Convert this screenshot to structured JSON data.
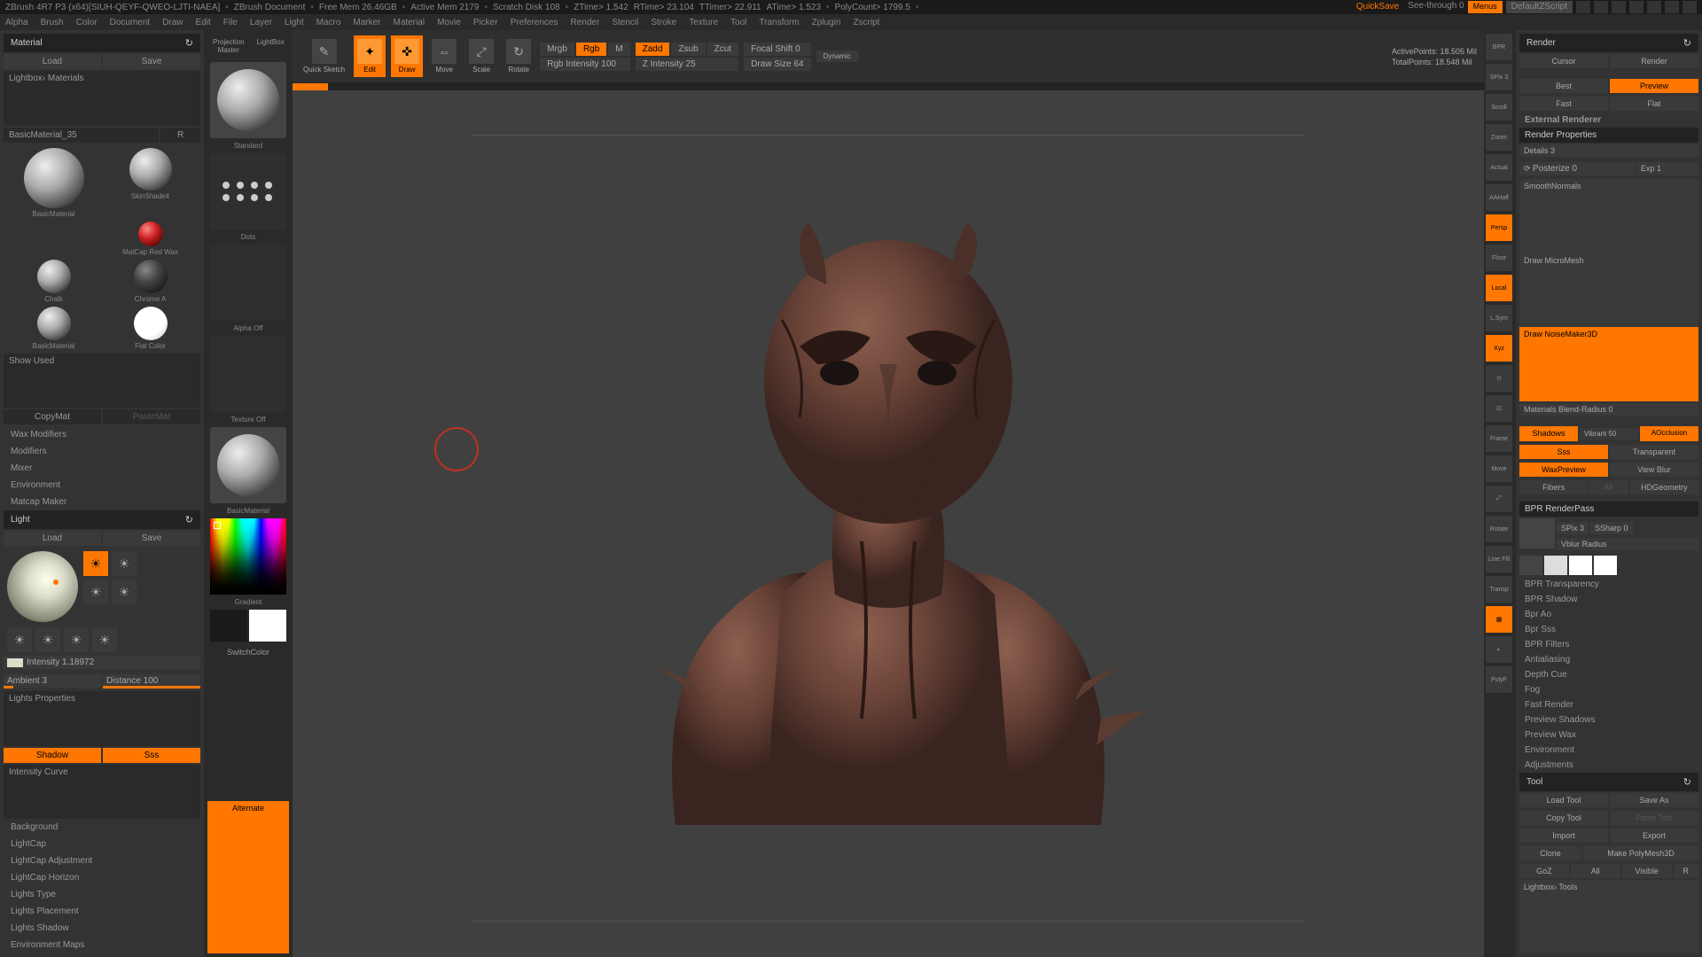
{
  "app": {
    "title": "ZBrush 4R7 P3 (x64)[SIUH-QEYF-QWEO-LJTI-NAEA]",
    "document": "ZBrush Document",
    "freeMem": "Free Mem 26.46GB",
    "activeMem": "Active Mem 2179",
    "scratchDisk": "Scratch Disk 108",
    "zTime": "ZTime> 1.542",
    "rTime": "RTime> 23.104",
    "tTimer": "TTimer> 22.911",
    "aTime": "ATime> 1.523",
    "polyCount": "PolyCount> 1799.5",
    "quickSave": "QuickSave",
    "seeThrough": "See-through 0",
    "menus": "Menus",
    "defaultScript": "DefaultZScript"
  },
  "menu": [
    "Alpha",
    "Brush",
    "Color",
    "Document",
    "Draw",
    "Edit",
    "File",
    "Layer",
    "Light",
    "Macro",
    "Marker",
    "Material",
    "Movie",
    "Picker",
    "Preferences",
    "Render",
    "Stencil",
    "Stroke",
    "Texture",
    "Tool",
    "Transform",
    "Zplugin",
    "Zscript"
  ],
  "material": {
    "title": "Material",
    "load": "Load",
    "save": "Save",
    "lightbox": "Lightbox› Materials",
    "current": "BasicMaterial_35",
    "r": "R",
    "swatches": [
      {
        "name": "BasicMaterial"
      },
      {
        "name": "SkinShade4"
      },
      {
        "name": "Chalk"
      },
      {
        "name": "MatCap Red Wax"
      },
      {
        "name": "Chalk"
      },
      {
        "name": "Chrome A"
      },
      {
        "name": "BasicMaterial"
      },
      {
        "name": "Flat Color"
      }
    ],
    "showUsed": "Show Used",
    "copyMat": "CopyMat",
    "pasteMat": "PasteMat",
    "sections": [
      "Wax Modifiers",
      "Modifiers",
      "Mixer",
      "Environment",
      "Matcap Maker"
    ]
  },
  "light": {
    "title": "Light",
    "load": "Load",
    "save": "Save",
    "intensity": "Intensity 1.18972",
    "ambient": "Ambient 3",
    "distance": "Distance 100",
    "propsHeader": "Lights Properties",
    "shadow": "Shadow",
    "sss": "Sss",
    "intensityCurve": "Intensity Curve",
    "sections": [
      "Background",
      "LightCap",
      "LightCap Adjustment",
      "LightCap Horizon",
      "Lights Type",
      "Lights Placement",
      "Lights Shadow",
      "Environment Maps"
    ]
  },
  "toolColumn": {
    "projection": "Projection Master",
    "lightbox": "LightBox",
    "standard": "Standard",
    "dots": "Dots",
    "alphaOff": "Alpha Off",
    "textureOff": "Texture Off",
    "basicMat": "BasicMaterial",
    "gradient": "Gradient",
    "switchColor": "SwitchColor",
    "alternate": "Alternate"
  },
  "toolbar": {
    "quickSketch": "Quick Sketch",
    "edit": "Edit",
    "draw": "Draw",
    "move": "Move",
    "scale": "Scale",
    "rotate": "Rotate",
    "mrgb": "Mrgb",
    "rgb": "Rgb",
    "m": "M",
    "rgbIntensity": "Rgb Intensity 100",
    "zadd": "Zadd",
    "zsub": "Zsub",
    "zcut": "Zcut",
    "zIntensity": "Z Intensity 25",
    "focalShift": "Focal Shift 0",
    "drawSize": "Draw Size 64",
    "dynamic": "Dynamic",
    "activePoints": "ActivePoints: 18.505 Mil",
    "totalPoints": "TotalPoints: 18.548 Mil"
  },
  "rightTools": [
    "BPR",
    "SPix 3",
    "Scroll",
    "Zoom",
    "Actual",
    "AAHalf",
    "Persp",
    "Floor",
    "Local",
    "L.Sym",
    "Xyz",
    "",
    "",
    "Frame",
    "Move",
    "",
    "Rotate",
    "Line Fill",
    "Transp",
    "Dynamic",
    "",
    "PolyF"
  ],
  "render": {
    "title": "Render",
    "cursor": "Cursor",
    "renderBtn": "Render",
    "best": "Best",
    "preview": "Preview",
    "fast": "Fast",
    "flat": "Flat",
    "external": "External Renderer",
    "props": "Render Properties",
    "details": "Details 3",
    "posterize": "Posterize 0",
    "exp": "Exp 1",
    "smoothNormals": "SmoothNormals",
    "drawMicro": "Draw MicroMesh",
    "drawNoise": "Draw NoiseMaker3D",
    "matBlend": "Materials Blend-Radius 0",
    "shadows": "Shadows",
    "vibrant": "Vibrant 50",
    "aocclusion": "AOcclusion",
    "sss": "Sss",
    "transparent": "Transparent",
    "waxPreview": "WaxPreview",
    "viewBlur": "View Blur",
    "fibers": "Fibers",
    "af": "AF",
    "hdgeometry": "HDGeometry",
    "bprPass": "BPR RenderPass",
    "spix": "SPix 3",
    "ssharp": "SSharp 0",
    "vblur": "Vblur Radius",
    "sections": [
      "BPR Transparency",
      "BPR Shadow",
      "Bpr Ao",
      "Bpr Sss",
      "BPR Filters",
      "Antialiasing",
      "Depth Cue",
      "Fog",
      "Fast Render",
      "Preview Shadows",
      "Preview Wax",
      "Environment",
      "Adjustments"
    ]
  },
  "tool": {
    "title": "Tool",
    "loadTool": "Load Tool",
    "saveAs": "Save As",
    "copyTool": "Copy Tool",
    "pasteTool": "Paste Tool",
    "import": "Import",
    "export": "Export",
    "clone": "Clone",
    "makePolymesh": "Make PolyMesh3D",
    "goz": "GoZ",
    "all": "All",
    "visible": "Visible",
    "r": "R",
    "lightboxTools": "Lightbox› Tools"
  }
}
